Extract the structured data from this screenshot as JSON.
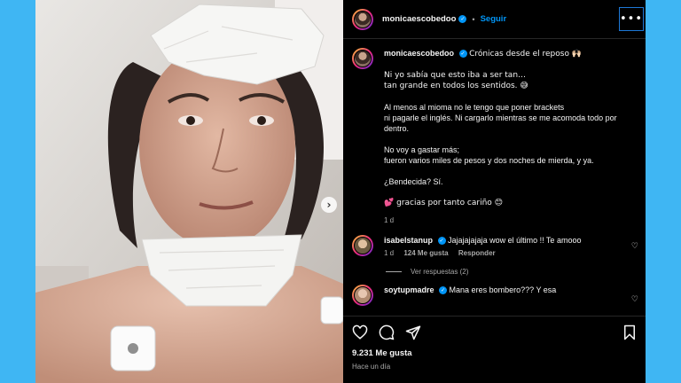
{
  "post": {
    "username": "monicaescobedoo",
    "follow_label": "Seguir",
    "more_label": "•••",
    "next_label": "›"
  },
  "caption": {
    "username": "monicaescobedoo",
    "first_line": "Crónicas desde el reposo 🙌🏻",
    "paragraphs": [
      "Ni yo sabía que esto iba a ser tan…\ntan grande en todos los sentidos. 😅",
      "Al menos al mioma no le tengo que poner brackets\nni pagarle el inglés. Ni cargarlo mientras se me acomoda todo por dentro.",
      "No voy a gastar más;\nfueron varios miles de pesos y dos noches de mierda, y ya.",
      "¿Bendecida? Sí.",
      "💕 gracias por tanto cariño 😊"
    ],
    "time": "1 d"
  },
  "comments": [
    {
      "username": "isabelstanup",
      "text": "Jajajajajaja wow el último !! Te amooo",
      "time": "1 d",
      "likes": "124 Me gusta",
      "reply": "Responder",
      "view_replies": "Ver respuestas (2)"
    },
    {
      "username": "soytupmadre",
      "text": "Mana eres bombero??? Y esa"
    }
  ],
  "footer": {
    "likes": "9.231 Me gusta",
    "time_ago": "Hace un día"
  },
  "icons": {
    "heart": "heart-icon",
    "comment": "comment-icon",
    "share": "share-icon",
    "save": "bookmark-icon"
  },
  "colors": {
    "background": "#3fb6f3",
    "accent": "#0095f6",
    "panel": "#000000"
  }
}
